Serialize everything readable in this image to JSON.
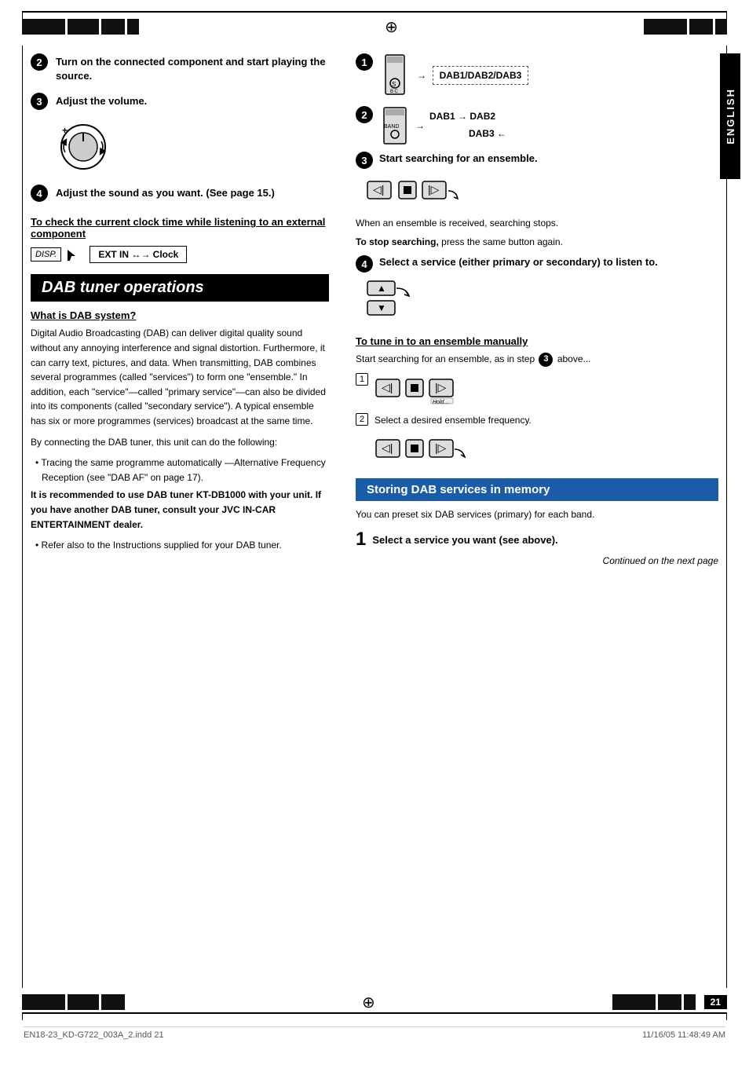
{
  "page": {
    "number": "21",
    "language": "ENGLISH",
    "footer_left": "EN18-23_KD-G722_003A_2.indd  21",
    "footer_right": "11/16/05  11:48:49 AM",
    "continued": "Continued on the next page"
  },
  "left_column": {
    "step2": {
      "label": "2",
      "text": "Turn on the connected component and start playing the source."
    },
    "step3": {
      "label": "3",
      "text": "Adjust the volume."
    },
    "step4": {
      "label": "4",
      "text": "Adjust the sound as you want. (See page 15.)"
    },
    "clock_check": {
      "title": "To check the current clock time while listening to an external component",
      "disp_label": "DISP.",
      "ext_in_label": "EXT IN",
      "arrow_label": "↔",
      "clock_label": "Clock"
    },
    "dab_section": {
      "title": "DAB tuner operations",
      "what_is_title": "What is DAB system?",
      "paragraph1": "Digital Audio Broadcasting (DAB) can deliver digital quality sound without any annoying interference and signal distortion. Furthermore, it can carry text, pictures, and data. When transmitting, DAB combines several programmes (called \"services\") to form one \"ensemble.\" In addition, each \"service\"—called \"primary service\"—can also be divided into its components (called \"secondary service\"). A typical ensemble has six or more programmes (services) broadcast at the same time.",
      "paragraph2": "By connecting the DAB tuner, this unit can do the following:",
      "bullet1": "Tracing the same programme automatically —Alternative Frequency Reception (see \"DAB AF\" on page 17).",
      "bold_notice": "It is recommended to use DAB tuner KT-DB1000 with your unit. If you have another DAB tuner, consult your JVC IN-CAR ENTERTAINMENT dealer.",
      "bullet2": "Refer also to the Instructions supplied for your DAB tuner."
    }
  },
  "right_column": {
    "step1_label": "1",
    "dab123_label": "DAB1/DAB2/DAB3",
    "step2_label": "2",
    "band_label": "BAND",
    "dab1_label": "DAB1",
    "dab2_label": "DAB2",
    "dab3_label": "DAB3",
    "step3": {
      "label": "3",
      "text": "Start searching for an ensemble.",
      "note1": "When an ensemble is received, searching stops.",
      "note2_bold": "To stop searching,",
      "note2": " press the same button again."
    },
    "step4": {
      "label": "4",
      "text": "Select a service (either primary or secondary) to listen to."
    },
    "tune_manually": {
      "title": "To tune in to an ensemble manually",
      "intro": "Start searching for an ensemble, as in step",
      "step3_ref": "3",
      "above": "above...",
      "substep1": "1",
      "hold_label": "Hold....",
      "substep2": "2",
      "substep2_text": "Select a desired ensemble frequency."
    },
    "storing": {
      "title": "Storing DAB services in memory",
      "description": "You can preset six DAB services (primary) for each band.",
      "step1_num": "1",
      "step1_text": "Select a service you want (see above)."
    }
  }
}
